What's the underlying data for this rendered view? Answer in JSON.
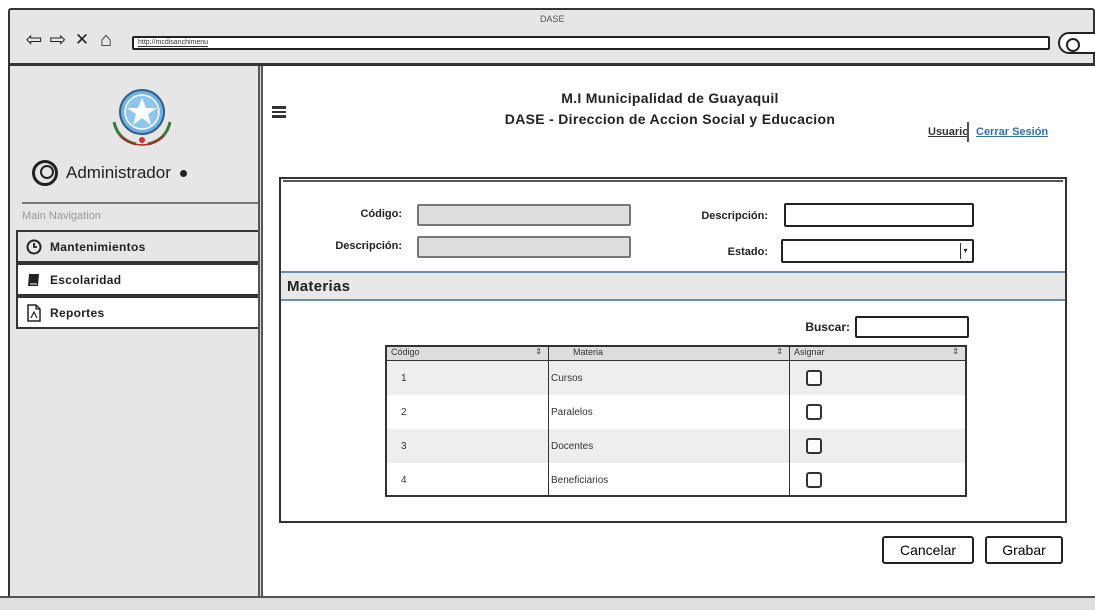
{
  "browser": {
    "title": "DASE",
    "url": "http://mcdisanchimenu"
  },
  "sidebar": {
    "admin_name": "Administrador",
    "nav_heading": "Main Navigation",
    "items": [
      {
        "label": "Mantenimientos",
        "icon": "clock-icon",
        "active": true
      },
      {
        "label": "Escolaridad",
        "icon": "book-icon",
        "active": false
      },
      {
        "label": "Reportes",
        "icon": "document-icon",
        "active": false
      }
    ]
  },
  "header": {
    "line1": "M.I Municipalidad de Guayaquil",
    "line2": "DASE - Direccion de Accion Social y Educacion",
    "user_link": "Usuario",
    "logout_link": "Cerrar Sesión"
  },
  "form": {
    "codigo_label": "Código:",
    "descripcion_left_label": "Descripción:",
    "descripcion_right_label": "Descripción:",
    "estado_label": "Estado:",
    "codigo_value": "",
    "descripcion_left_value": "",
    "descripcion_right_value": "",
    "estado_value": ""
  },
  "materias": {
    "section_title": "Materias",
    "search_label": "Buscar:",
    "search_value": "",
    "columns": [
      "Código",
      "Materia",
      "Asignar"
    ],
    "rows": [
      {
        "codigo": "1",
        "materia": "Cursos",
        "asignar": false
      },
      {
        "codigo": "2",
        "materia": "Paralelos",
        "asignar": false
      },
      {
        "codigo": "3",
        "materia": "Docentes",
        "asignar": false
      },
      {
        "codigo": "4",
        "materia": "Beneficiarios",
        "asignar": false
      }
    ]
  },
  "actions": {
    "cancel_label": "Cancelar",
    "save_label": "Grabar"
  },
  "colors": {
    "link_blue": "#2f6fb0",
    "sidebar_bg": "#e6e6e6",
    "readonly_field": "#dddddd"
  }
}
